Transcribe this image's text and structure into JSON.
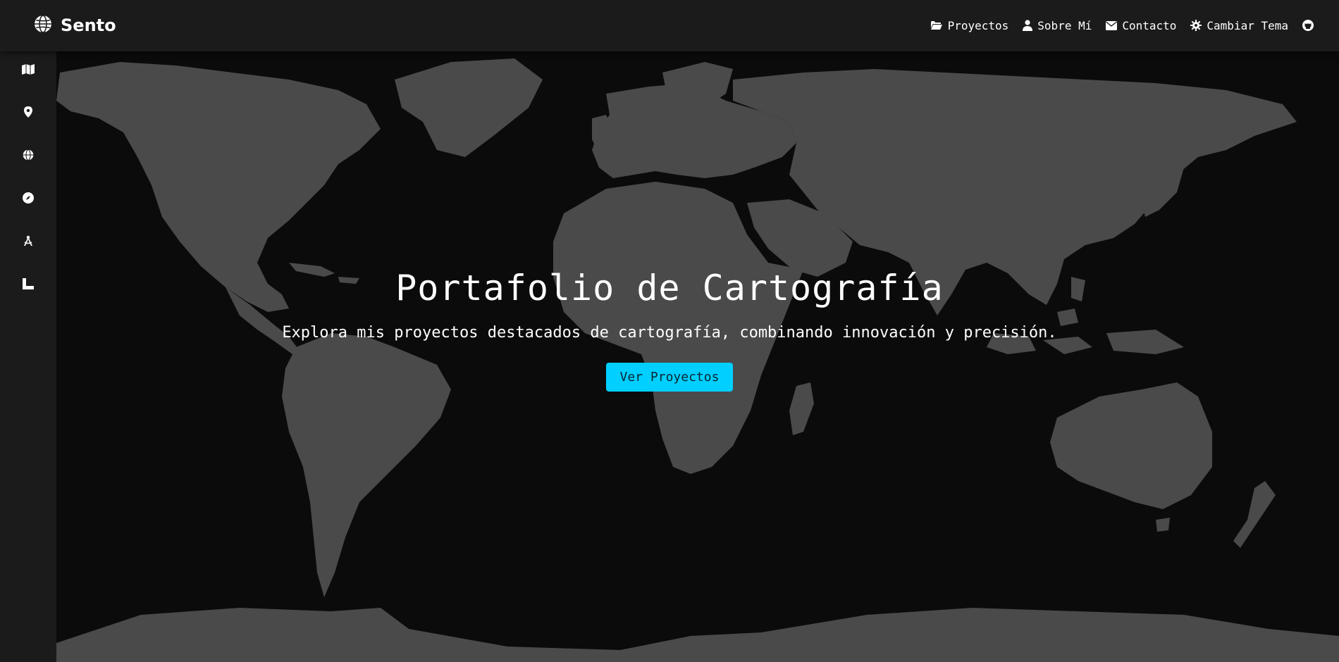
{
  "brand": {
    "icon": "globe-icon",
    "name": "Sento"
  },
  "nav": {
    "items": [
      {
        "icon": "folder-open-icon",
        "label": "Proyectos"
      },
      {
        "icon": "user-icon",
        "label": "Sobre Mí"
      },
      {
        "icon": "envelope-icon",
        "label": "Contacto"
      },
      {
        "icon": "gear-icon",
        "label": "Cambiar Tema"
      },
      {
        "icon": "github-icon",
        "label": ""
      }
    ]
  },
  "sidebar": {
    "items": [
      {
        "icon": "map-icon"
      },
      {
        "icon": "map-pin-icon"
      },
      {
        "icon": "globe-icon"
      },
      {
        "icon": "compass-icon"
      },
      {
        "icon": "drafting-compass-icon"
      },
      {
        "icon": "ruler-combined-icon"
      }
    ]
  },
  "hero": {
    "title": "Portafolio de Cartografía",
    "subtitle": "Explora mis proyectos destacados de cartografía, combinando innovación y precisión.",
    "cta_label": "Ver Proyectos"
  },
  "colors": {
    "background": "#0b0b0b",
    "panel": "#1b1b1b",
    "land": "#4a4a4a",
    "accent": "#00cfff"
  }
}
